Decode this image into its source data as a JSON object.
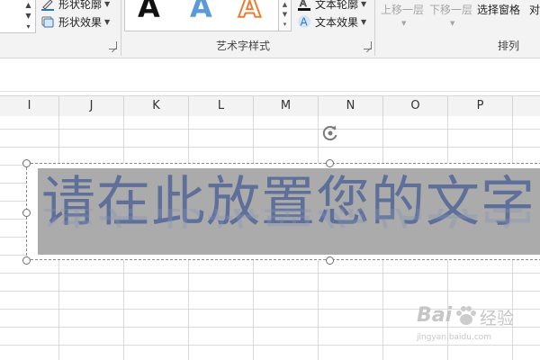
{
  "ribbon": {
    "shape_group": {
      "outline_label": "形状轮廓",
      "effects_label": "形状效果"
    },
    "wordart_group": {
      "label": "艺术字样式",
      "style_sample_text": "A",
      "text_outline_label": "文本轮廓",
      "text_effects_label": "文本效果"
    },
    "arrange_group": {
      "label": "排列",
      "bring_forward_label": "上移一层",
      "send_backward_label": "下移一层",
      "selection_pane_label": "选择窗格",
      "align_label": "对"
    }
  },
  "columns": [
    "I",
    "J",
    "K",
    "L",
    "M",
    "N",
    "O",
    "P"
  ],
  "textbox": {
    "text": "请在此放置您的文字"
  },
  "watermark": {
    "brand": "Bai",
    "brand_cn": "经验",
    "url": "jingyan.baidu.com"
  },
  "colors": {
    "wordart_text": "#5e6f99",
    "textbox_fill": "#ababab",
    "ribbon_bg": "#f3f3f3",
    "wordart_blue_sample": "#5b9bd5",
    "wordart_orange_sample": "#ed7d31"
  }
}
